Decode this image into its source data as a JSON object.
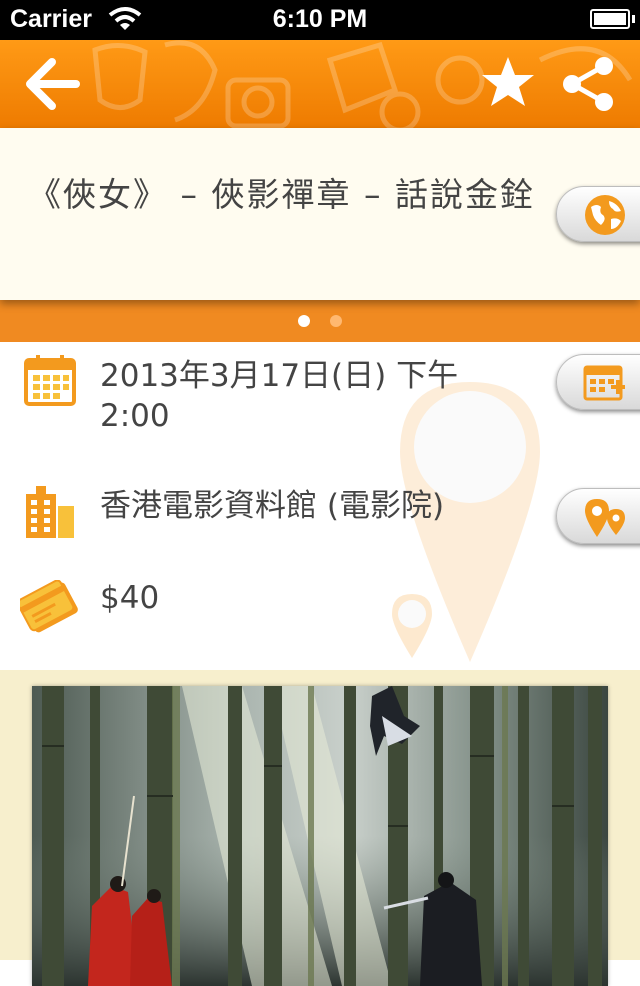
{
  "status_bar": {
    "carrier": "Carrier",
    "time": "6:10 PM"
  },
  "nav": {
    "back_icon": "back-arrow-icon",
    "favorite_icon": "star-icon",
    "share_icon": "share-icon"
  },
  "event": {
    "title": "《俠女》 – 俠影禪章 – 話說金銓",
    "website_icon": "globe-icon",
    "datetime": "2013年3月17日(日) 下午 2:00",
    "calendar_icon": "calendar-icon",
    "add_to_calendar_icon": "calendar-add-icon",
    "venue": "香港電影資料館 (電影院)",
    "venue_icon": "building-icon",
    "map_icon": "map-pin-icon",
    "price": "$40",
    "price_icon": "ticket-icon"
  },
  "pager": {
    "pages": 2,
    "current": 1
  },
  "colors": {
    "accent": "#f08a21",
    "nav_top": "#ff9a16",
    "card_bg": "#fffcf0",
    "photo_bg": "#f7efcd"
  }
}
